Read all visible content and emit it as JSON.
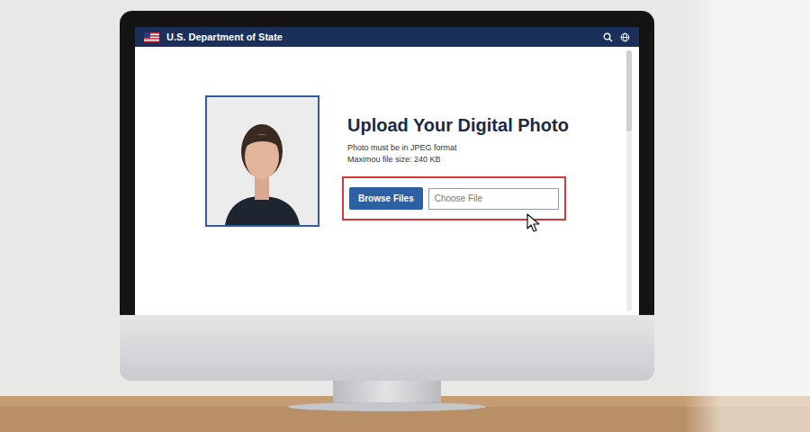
{
  "browser_header": {
    "title": "U.S. Department of State"
  },
  "upload": {
    "title": "Upload Your Digital Photo",
    "requirements": [
      "Photo must be in JPEG format",
      "Maximou file size: 240 KB"
    ],
    "browse_button": "Browse Files",
    "file_input": {
      "placeholder": "Choose File"
    }
  }
}
